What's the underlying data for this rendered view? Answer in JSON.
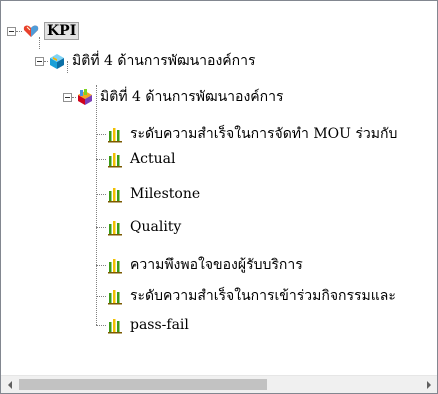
{
  "tree": {
    "root": {
      "label": "KPI",
      "icon": "heart-gem-icon"
    },
    "level1": {
      "label": "มิติที่ 4 ด้านการพัฒนาองค์การ",
      "icon": "cube-icon"
    },
    "level2": {
      "label": "มิติที่ 4 ด้านการพัฒนาองค์การ",
      "icon": "chart-cube-icon"
    },
    "leaves": [
      {
        "label": "ระดับความสำเร็จในการจัดทำ MOU ร่วมกับ",
        "icon": "bar-chart-icon"
      },
      {
        "label": "Actual",
        "icon": "bar-chart-icon"
      },
      {
        "label": "Milestone",
        "icon": "bar-chart-icon"
      },
      {
        "label": "Quality",
        "icon": "bar-chart-icon"
      },
      {
        "label": "ความพึงพอใจของผู้รับบริการ",
        "icon": "bar-chart-icon"
      },
      {
        "label": "ระดับความสำเร็จในการเข้าร่วมกิจกรรมและ",
        "icon": "bar-chart-icon"
      },
      {
        "label": "pass-fail",
        "icon": "bar-chart-icon"
      }
    ]
  },
  "scrollbar": {
    "position": 0.0,
    "visible_fraction": 0.62
  },
  "colors": {
    "bar_green": "#3a9a16",
    "bar_yellow": "#f0c000",
    "bar_baseline": "#7a5a00",
    "selection_bg": "#e3e3e3"
  }
}
